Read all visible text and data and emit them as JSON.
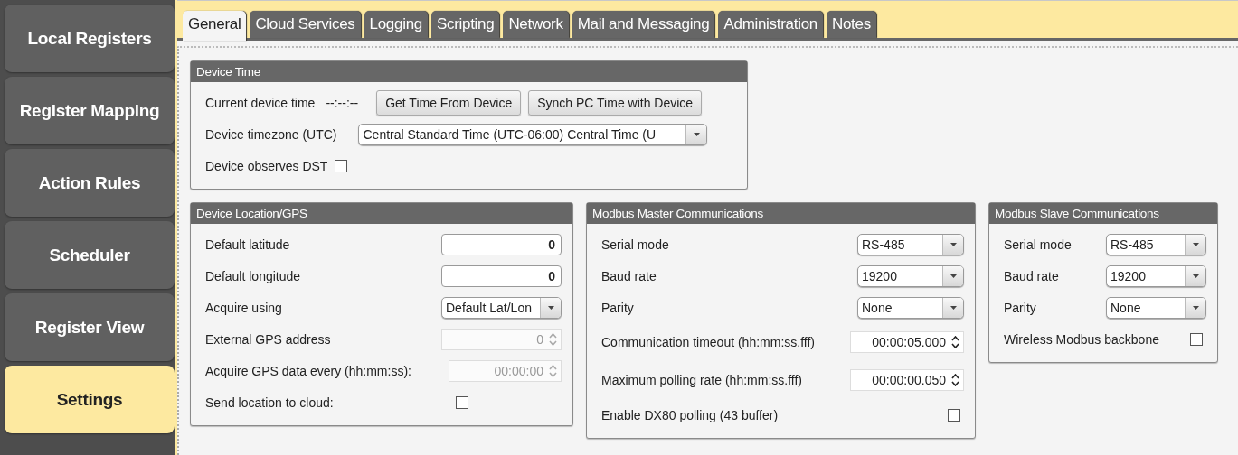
{
  "sidebar": {
    "items": [
      {
        "label": "Local Registers",
        "selected": false
      },
      {
        "label": "Register Mapping",
        "selected": false
      },
      {
        "label": "Action Rules",
        "selected": false
      },
      {
        "label": "Scheduler",
        "selected": false
      },
      {
        "label": "Register View",
        "selected": false
      },
      {
        "label": "Settings",
        "selected": true
      }
    ]
  },
  "tabs": [
    {
      "label": "General",
      "selected": true
    },
    {
      "label": "Cloud Services",
      "selected": false
    },
    {
      "label": "Logging",
      "selected": false
    },
    {
      "label": "Scripting",
      "selected": false
    },
    {
      "label": "Network",
      "selected": false
    },
    {
      "label": "Mail and Messaging",
      "selected": false
    },
    {
      "label": "Administration",
      "selected": false
    },
    {
      "label": "Notes",
      "selected": false
    }
  ],
  "panels": [
    {
      "title": "Device Time",
      "rows": [
        {
          "kind": "time",
          "label": "Current device time",
          "value": "--:--:--",
          "buttons": [
            "Get Time From Device",
            "Synch PC Time with Device"
          ]
        },
        {
          "kind": "select",
          "label": "Device timezone (UTC)",
          "value": "Central Standard Time (UTC-06:00) Central Time (U"
        },
        {
          "kind": "checkbox",
          "label": "Device observes DST",
          "checked": false
        }
      ]
    },
    {
      "title": "Device Location/GPS",
      "rows": [
        {
          "kind": "input",
          "label": "Default latitude",
          "value": "0"
        },
        {
          "kind": "input",
          "label": "Default longitude",
          "value": "0"
        },
        {
          "kind": "select",
          "label": "Acquire using",
          "value": "Default Lat/Lon"
        },
        {
          "kind": "spin",
          "label": "External GPS address",
          "value": "0",
          "disabled": true
        },
        {
          "kind": "spin",
          "label": "Acquire GPS data every (hh:mm:ss):",
          "value": "00:00:00",
          "disabled": true
        },
        {
          "kind": "checkbox",
          "label": "Send location to cloud:",
          "checked": false
        }
      ]
    },
    {
      "title": "Modbus Master Communications",
      "rows": [
        {
          "kind": "select",
          "label": "Serial mode",
          "value": "RS-485"
        },
        {
          "kind": "select",
          "label": "Baud rate",
          "value": "19200"
        },
        {
          "kind": "select",
          "label": "Parity",
          "value": "None"
        },
        {
          "kind": "spin",
          "label": "Communication timeout (hh:mm:ss.fff)",
          "value": "00:00:05.000",
          "disabled": false
        },
        {
          "kind": "spin",
          "label": "Maximum polling rate (hh:mm:ss.fff)",
          "value": "00:00:00.050",
          "disabled": false
        },
        {
          "kind": "checkbox",
          "label": "Enable DX80 polling (43 buffer)",
          "checked": false
        }
      ]
    },
    {
      "title": "Modbus Slave Communications",
      "rows": [
        {
          "kind": "select",
          "label": "Serial mode",
          "value": "RS-485"
        },
        {
          "kind": "select",
          "label": "Baud rate",
          "value": "19200"
        },
        {
          "kind": "select",
          "label": "Parity",
          "value": "None"
        },
        {
          "kind": "checkbox",
          "label": "Wireless Modbus backbone",
          "checked": false
        }
      ]
    }
  ]
}
